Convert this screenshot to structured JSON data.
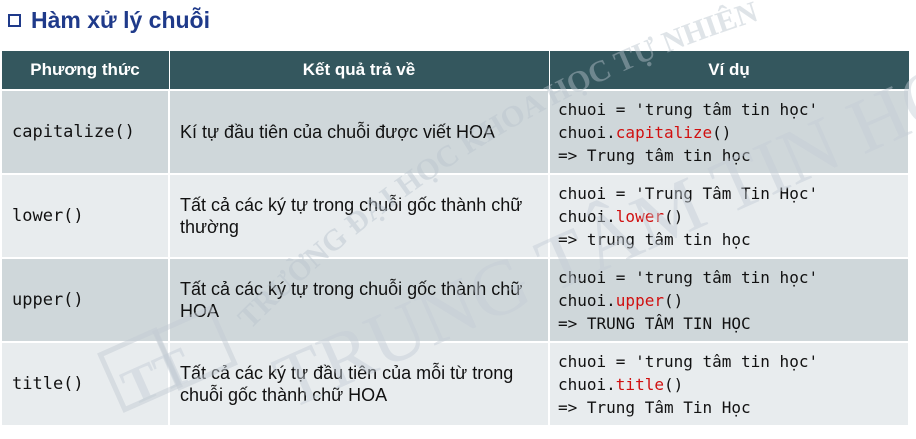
{
  "heading": {
    "text": "Hàm xử lý chuỗi",
    "icon": "checkbox-icon",
    "color": "#1f3a8a"
  },
  "table": {
    "header_color": "#34575e",
    "headers": [
      "Phương thức",
      "Kết quả trả về",
      "Ví dụ"
    ],
    "rows": [
      {
        "method": "capitalize()",
        "description": "Kí tự đầu tiên của chuỗi được viết HOA",
        "example": {
          "line1": "chuoi = 'trung tâm tin học'",
          "line2_prefix": "chuoi.",
          "line2_fn": "capitalize",
          "line2_suffix": "()",
          "line3": "=> Trung tâm tin học"
        }
      },
      {
        "method": "lower()",
        "description": "Tất cả các ký tự trong chuỗi gốc thành chữ thường",
        "example": {
          "line1": "chuoi = 'Trung Tâm Tin Học'",
          "line2_prefix": "chuoi.",
          "line2_fn": "lower",
          "line2_suffix": "()",
          "line3": "=> trung tâm tin học"
        }
      },
      {
        "method": "upper()",
        "description": "Tất cả các ký tự trong chuỗi gốc thành chữ HOA",
        "example": {
          "line1": "chuoi = 'trung tâm tin học'",
          "line2_prefix": "chuoi.",
          "line2_fn": "upper",
          "line2_suffix": "()",
          "line3": "=> TRUNG TÂM TIN HỌC"
        }
      },
      {
        "method": "title()",
        "description": "Tất cả các ký tự đầu tiên của mỗi từ trong chuỗi gốc thành chữ HOA",
        "example": {
          "line1": "chuoi = 'trung tâm tin học'",
          "line2_prefix": "chuoi.",
          "line2_fn": "title",
          "line2_suffix": "()",
          "line3": "=> Trung Tâm Tin Học"
        }
      }
    ]
  },
  "watermark": {
    "arc_text": "TRƯỜNG ĐẠI HỌC KHOA HỌC TỰ NHIÊN",
    "main_text": "TRUNG TÂM TIN HỌC",
    "logo_letters": "TT"
  }
}
